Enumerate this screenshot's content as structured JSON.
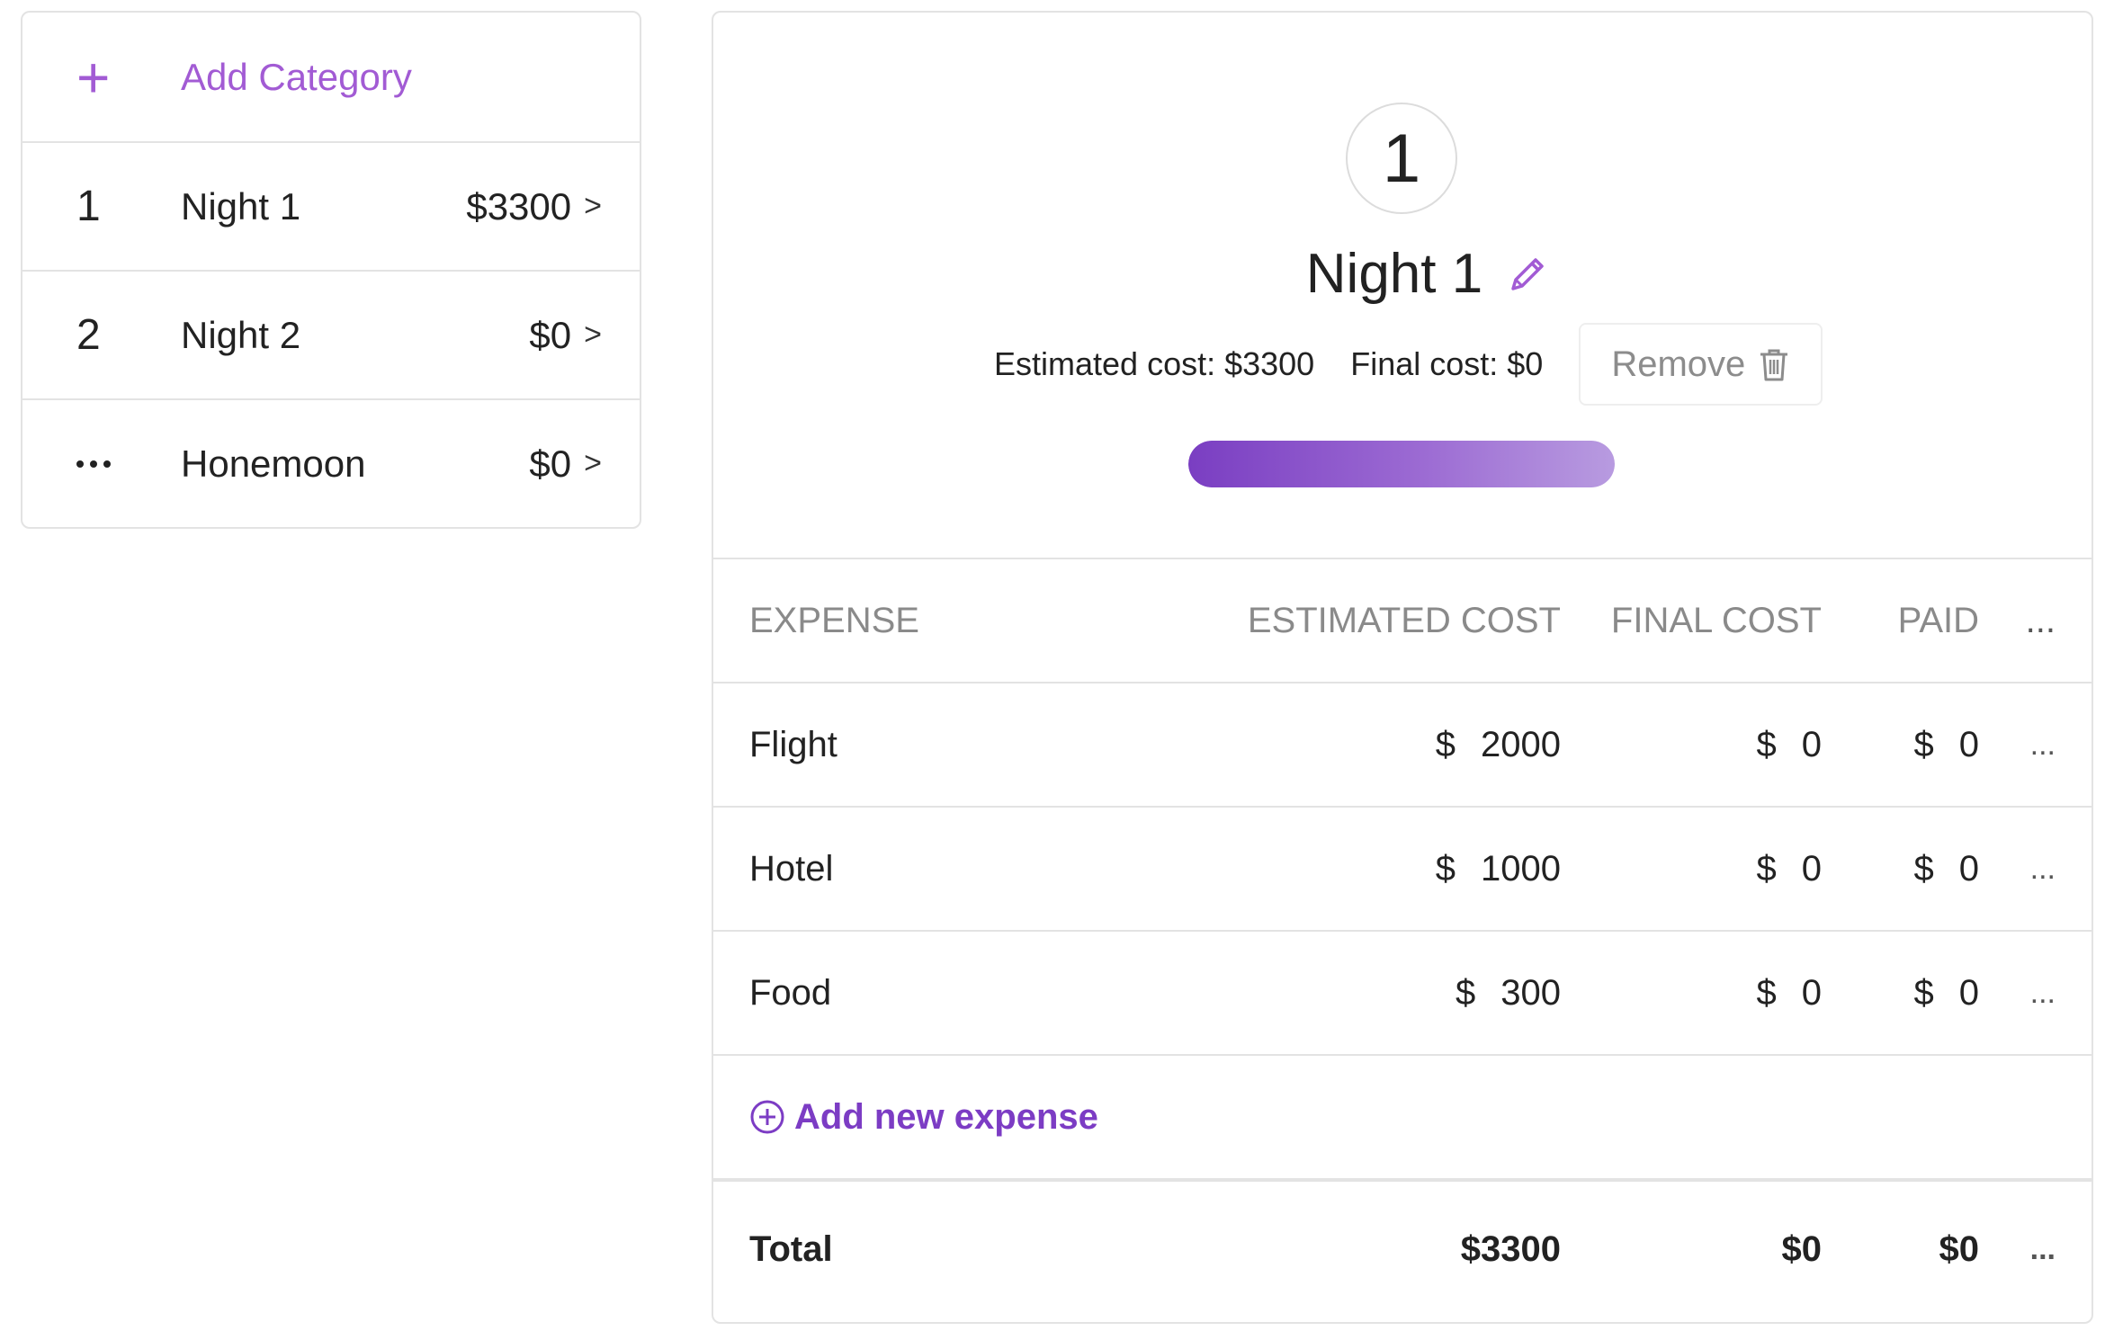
{
  "sidebar": {
    "add_category": {
      "icon": "plus-icon",
      "label": "Add Category"
    },
    "items": [
      {
        "lead": "1",
        "label": "Night 1",
        "amount": "$3300",
        "chevron": ">"
      },
      {
        "lead": "2",
        "label": "Night 2",
        "amount": "$0",
        "chevron": ">"
      },
      {
        "lead_icon": "more-dots-icon",
        "label": "Honemoon",
        "amount": "$0",
        "chevron": ">"
      }
    ]
  },
  "header": {
    "badge": "1",
    "title": "Night 1",
    "edit_icon": "pencil-icon",
    "estimated_cost": "Estimated cost: $3300",
    "final_cost": "Final cost: $0",
    "remove_label": "Remove",
    "remove_icon": "trash-icon",
    "progress_fraction": 1.0,
    "accent_color": "#7c3cc4"
  },
  "table": {
    "columns": [
      "EXPENSE",
      "ESTIMATED COST",
      "FINAL COST",
      "PAID",
      "..."
    ],
    "currency": "$",
    "rows": [
      {
        "expense": "Flight",
        "estimated": "2000",
        "final": "0",
        "paid": "0",
        "more": "..."
      },
      {
        "expense": "Hotel",
        "estimated": "1000",
        "final": "0",
        "paid": "0",
        "more": "..."
      },
      {
        "expense": "Food",
        "estimated": "300",
        "final": "0",
        "paid": "0",
        "more": "..."
      }
    ],
    "add_expense": {
      "icon": "plus-circle-icon",
      "label": "Add new expense"
    },
    "total": {
      "label": "Total",
      "estimated": "$3300",
      "final": "$0",
      "paid": "$0",
      "more": "..."
    }
  }
}
